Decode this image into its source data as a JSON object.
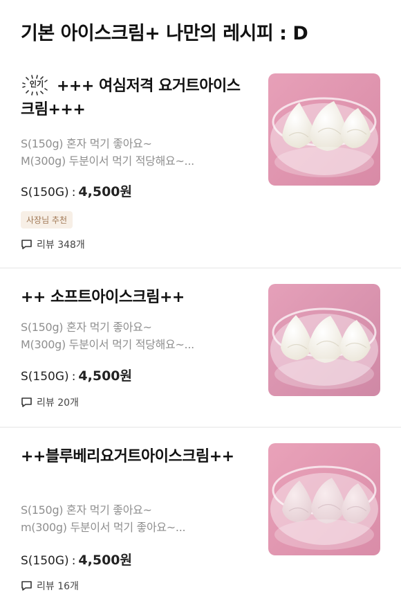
{
  "section": {
    "title": "기본 아이스크림+ 나만의 레시피 : D"
  },
  "items": [
    {
      "badge": "인기",
      "title": "+++ 여심저격 요거트아이스크림+++",
      "desc_line1": "S(150g) 혼자 먹기 좋아요~",
      "desc_line2": "M(300g) 두분이서 먹기 적당해요~...",
      "price_size": "S(150G)",
      "price_colon": ":",
      "price_value": "4,500원",
      "owner_badge": "사장님 추천",
      "review": "리뷰 348개",
      "image_icon": "ice-cream-photo"
    },
    {
      "title": "++ 소프트아이스크림++",
      "desc_line1": "S(150g) 혼자 먹기 좋아요~",
      "desc_line2": "M(300g) 두분이서 먹기 적당해요~...",
      "price_size": "S(150G)",
      "price_colon": ":",
      "price_value": "4,500원",
      "review": "리뷰 20개",
      "image_icon": "ice-cream-photo"
    },
    {
      "title": "++블루베리요거트아이스크림++",
      "desc_line1": "S(150g) 혼자 먹기 좋아요~",
      "desc_line2": "m(300g) 두분이서 먹기 좋아요~...",
      "price_size": "S(150G)",
      "price_colon": ":",
      "price_value": "4,500원",
      "review": "리뷰 16개",
      "image_icon": "ice-cream-photo"
    }
  ],
  "colors": {
    "background": "#ffffff",
    "title": "#111111",
    "description": "#8f8f8f",
    "badge_bg": "#f7efe6",
    "badge_text": "#a07855",
    "thumb_pink": "#e9a6bb"
  }
}
